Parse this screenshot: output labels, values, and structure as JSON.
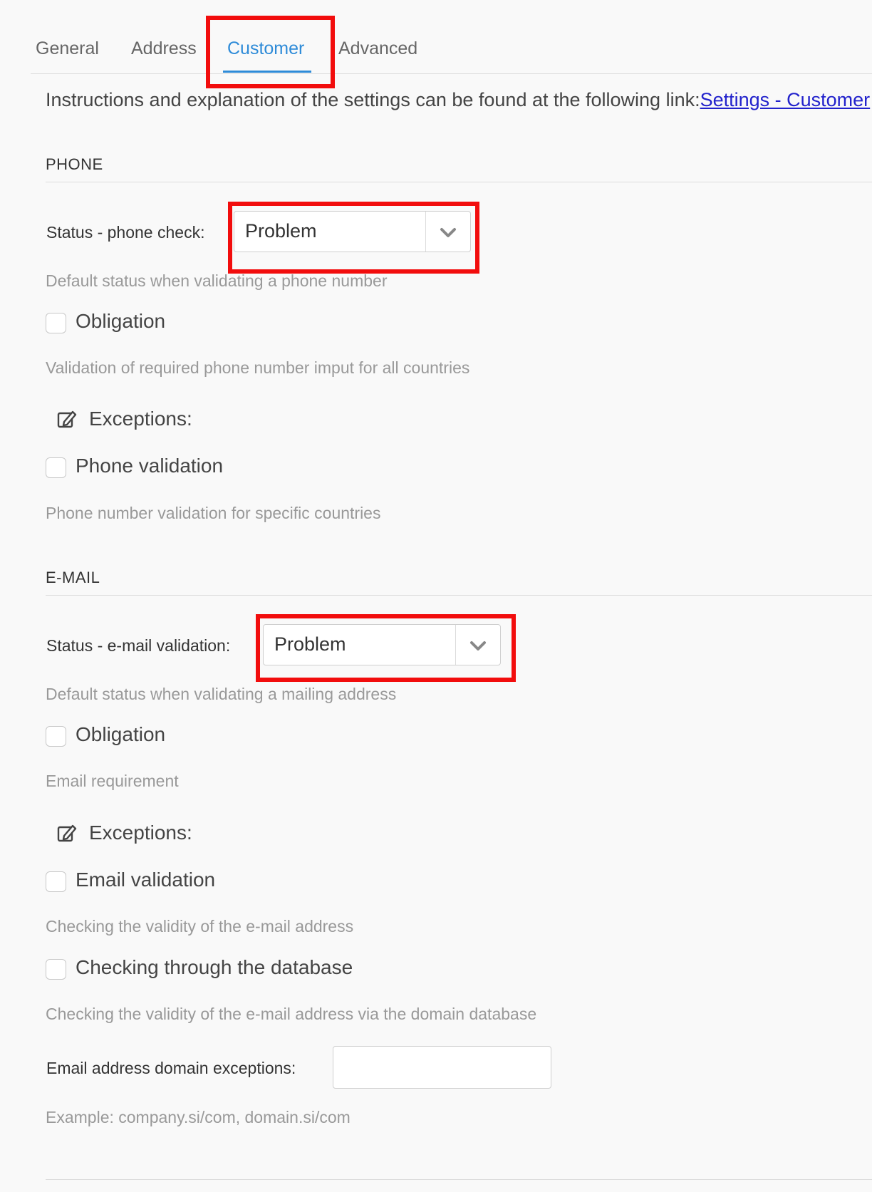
{
  "tabs": [
    "General",
    "Address",
    "Customer",
    "Advanced"
  ],
  "active_tab": "Customer",
  "instructions": {
    "text": "Instructions and explanation of the settings can be found at the following link:",
    "link": "Settings - Customer"
  },
  "phone": {
    "title": "PHONE",
    "status_label": "Status - phone check:",
    "status_value": "Problem",
    "status_help": "Default status when validating a phone number",
    "obligation_label": "Obligation",
    "obligation_help": "Validation of required phone number imput for all countries",
    "exceptions_label": "Exceptions:",
    "validation_label": "Phone validation",
    "validation_help": "Phone number validation for specific countries"
  },
  "email": {
    "title": "E-MAIL",
    "status_label": "Status - e-mail validation:",
    "status_value": "Problem",
    "status_help": "Default status when validating a mailing address",
    "obligation_label": "Obligation",
    "obligation_help": "Email requirement",
    "exceptions_label": "Exceptions:",
    "validation_label": "Email validation",
    "validation_help": "Checking the validity of the e-mail address",
    "database_label": "Checking through the database",
    "database_help": "Checking the validity of the e-mail address via the domain database",
    "domain_exceptions_label": "Email address domain exceptions:",
    "domain_exceptions_value": "",
    "domain_exceptions_help": "Example: company.si/com, domain.si/com"
  },
  "colors": {
    "accent": "#2e8bd8",
    "highlight": "#f20d0d",
    "link": "#2222cc"
  }
}
